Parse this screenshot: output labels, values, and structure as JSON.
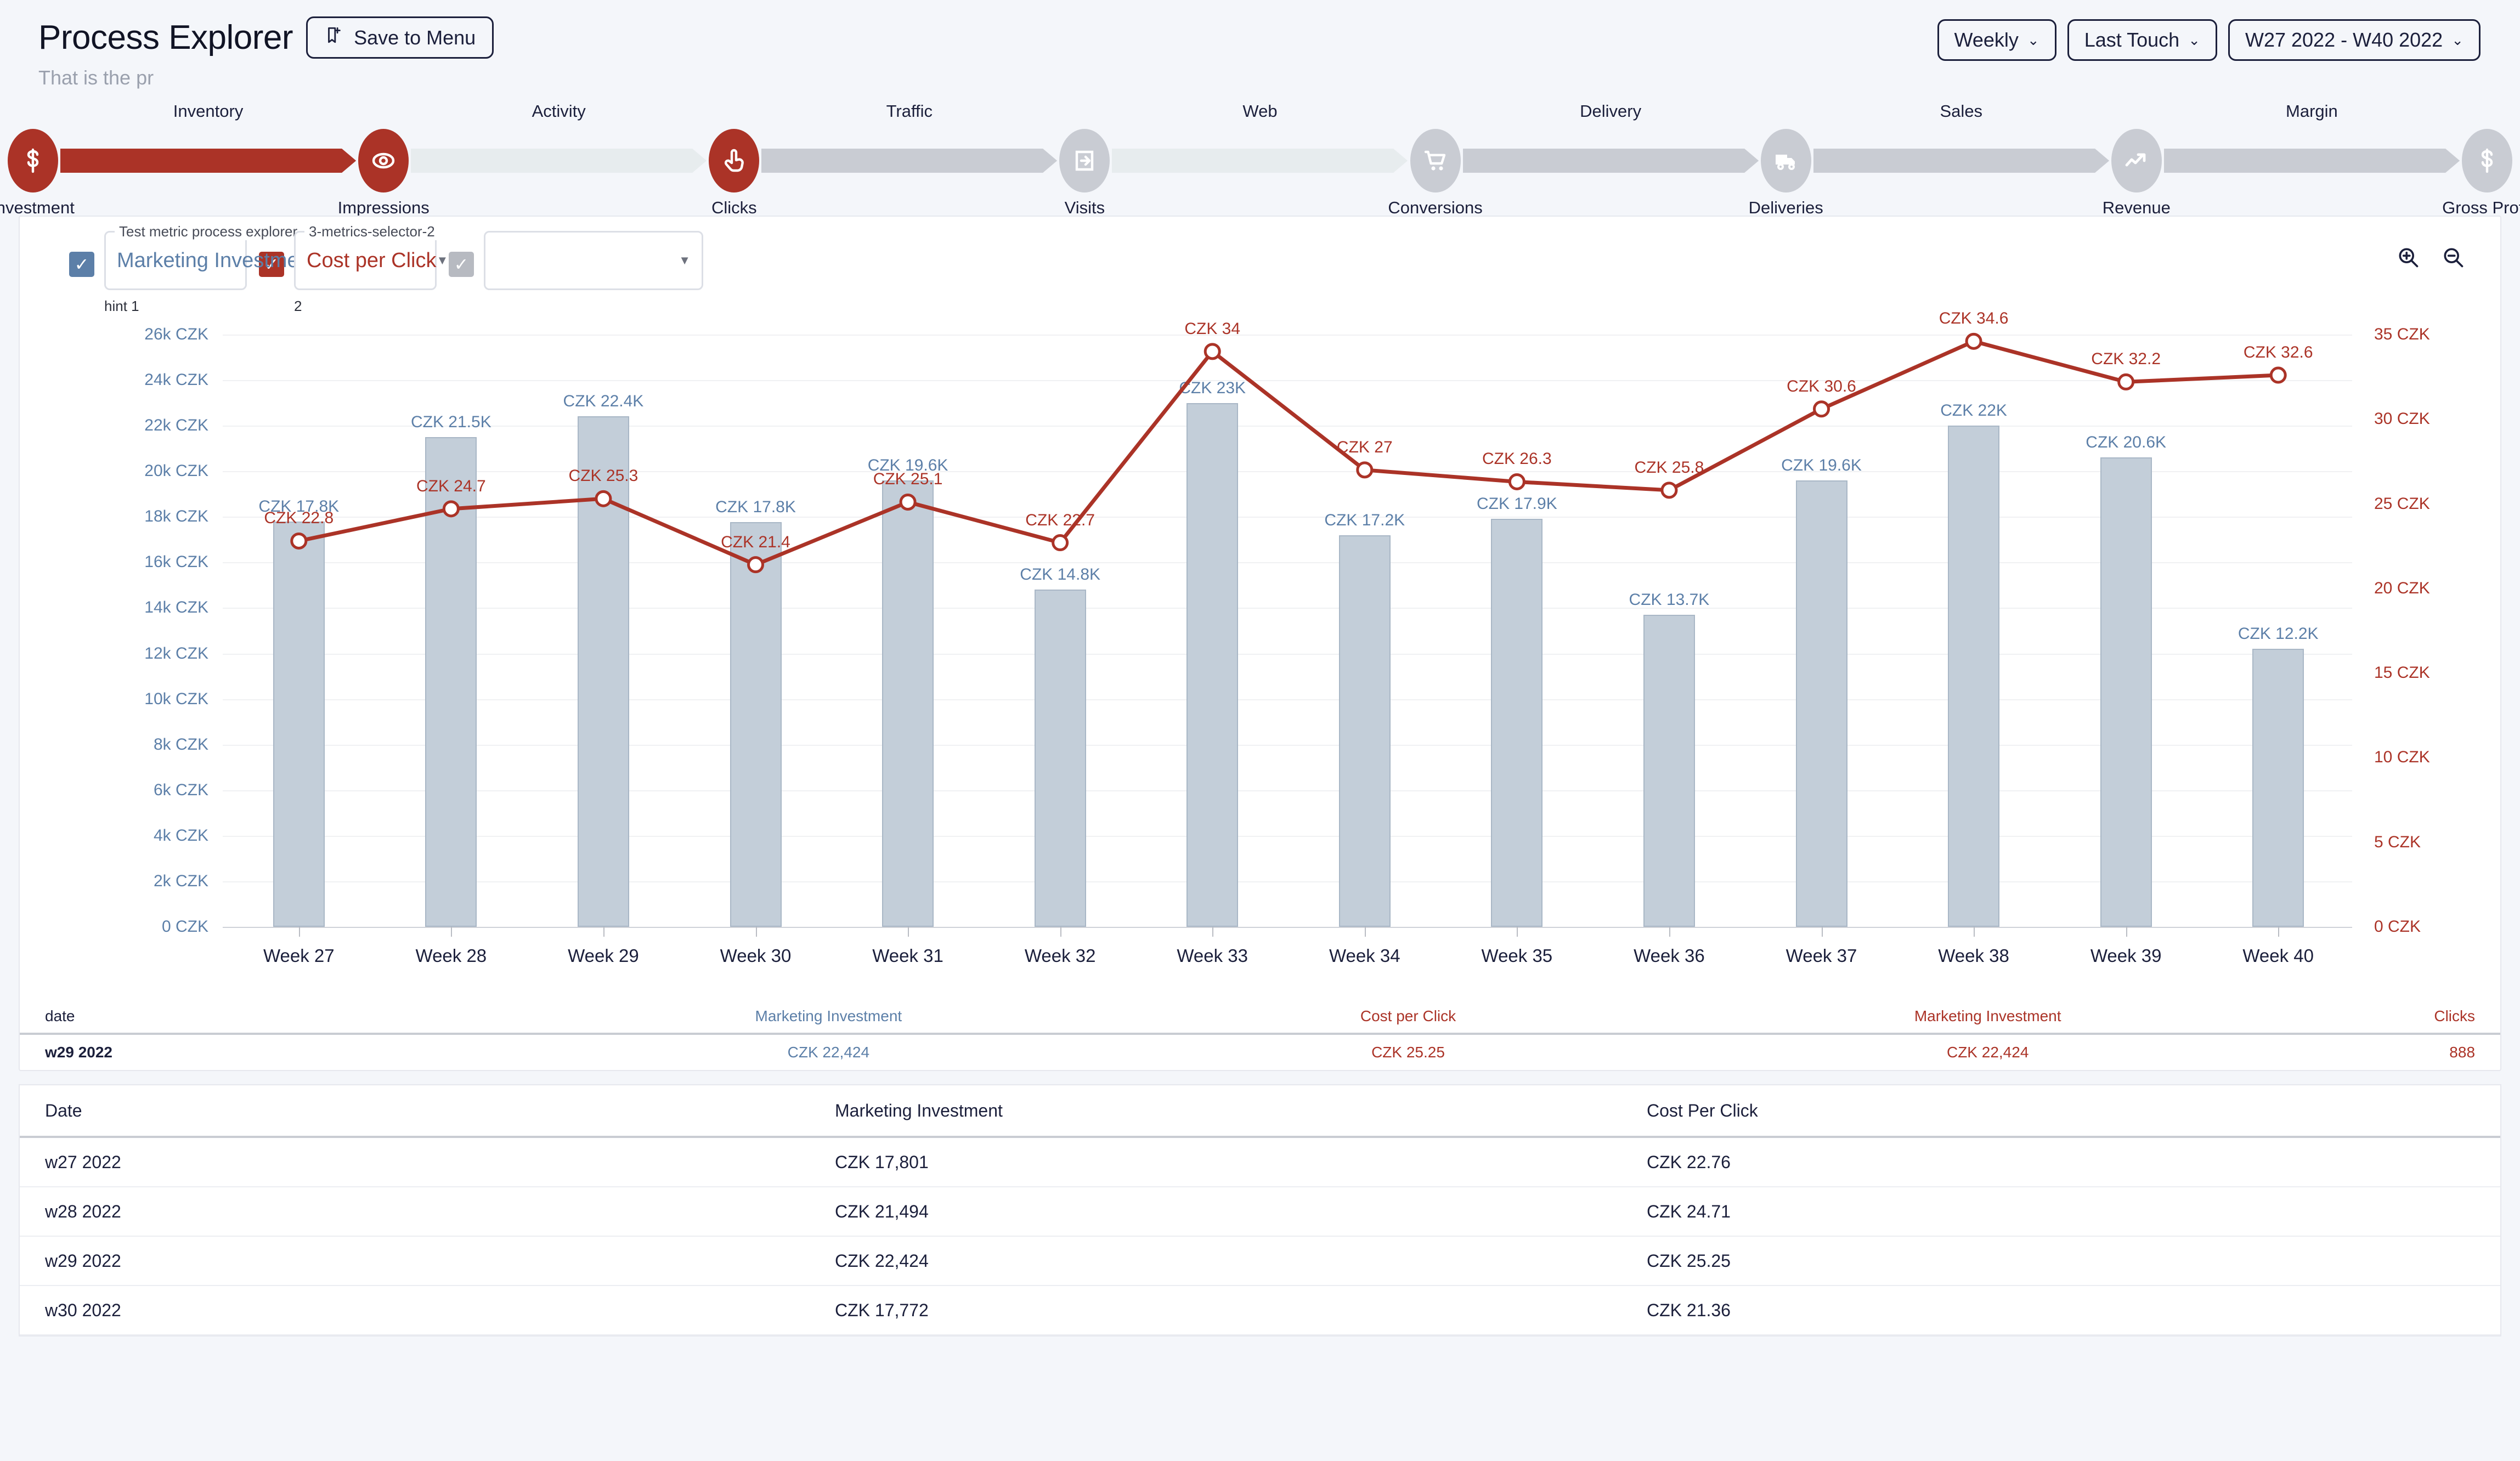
{
  "header": {
    "title": "Process Explorer",
    "subtitle": "That is the pr",
    "save_label": "Save to Menu",
    "save_icon": "bookmark-plus-icon",
    "controls": [
      {
        "label": "Weekly",
        "name": "granularity-select"
      },
      {
        "label": "Last Touch",
        "name": "attribution-select"
      },
      {
        "label": "W27 2022 - W40 2022",
        "name": "date-range-select"
      }
    ],
    "caret": "⌄"
  },
  "flow": {
    "nodes": [
      {
        "label": "Investment",
        "icon": "dollar-icon",
        "state": "active"
      },
      {
        "label": "Impressions",
        "icon": "eye-icon",
        "state": "active"
      },
      {
        "label": "Clicks",
        "icon": "click-icon",
        "state": "active"
      },
      {
        "label": "Visits",
        "icon": "login-icon",
        "state": "inactive"
      },
      {
        "label": "Conversions",
        "icon": "cart-icon",
        "state": "inactive"
      },
      {
        "label": "Deliveries",
        "icon": "truck-icon",
        "state": "inactive"
      },
      {
        "label": "Revenue",
        "icon": "trend-up-icon",
        "state": "inactive"
      },
      {
        "label": "Gross Profit",
        "icon": "dollar-icon",
        "state": "inactive"
      }
    ],
    "edges": [
      {
        "label": "Inventory",
        "state": "active"
      },
      {
        "label": "Activity",
        "state": "faint"
      },
      {
        "label": "Traffic",
        "state": "grey"
      },
      {
        "label": "Web",
        "state": "faint"
      },
      {
        "label": "Delivery",
        "state": "grey"
      },
      {
        "label": "Sales",
        "state": "grey"
      },
      {
        "label": "Margin",
        "state": "grey"
      }
    ]
  },
  "metric_selector": {
    "items": [
      {
        "legend": "Test metric process explorer",
        "value": "Marketing Investment",
        "hint": "hint 1",
        "checked": true,
        "color": "#5c7fa8",
        "check_color": "#5c7fa8"
      },
      {
        "legend": "3-metrics-selector-2",
        "value": "Cost per Click",
        "hint": "2",
        "checked": true,
        "color": "#ab3327",
        "check_color": "#ab3327"
      },
      {
        "legend": "",
        "value": "",
        "hint": "",
        "checked": true,
        "color": "#1b1f3b",
        "check_color": "#b7bac1"
      }
    ],
    "caret": "▼",
    "check_glyph": "✓"
  },
  "zoom_tools": [
    {
      "name": "zoom-in-icon",
      "title": "Zoom in"
    },
    {
      "name": "zoom-out-icon",
      "title": "Zoom out"
    }
  ],
  "chart_data": {
    "type": "bar",
    "title": "",
    "xlabel": "",
    "ylabel": "",
    "grid": true,
    "legend_position": "top",
    "categories": [
      "Week 27",
      "Week 28",
      "Week 29",
      "Week 30",
      "Week 31",
      "Week 32",
      "Week 33",
      "Week 34",
      "Week 35",
      "Week 36",
      "Week 37",
      "Week 38",
      "Week 39",
      "Week 40"
    ],
    "left_axis": {
      "label_color": "#5c7fa8",
      "ylim": [
        0,
        26000
      ],
      "ticks": [
        "0 CZK",
        "2k CZK",
        "4k CZK",
        "6k CZK",
        "8k CZK",
        "10k CZK",
        "12k CZK",
        "14k CZK",
        "16k CZK",
        "18k CZK",
        "20k CZK",
        "22k CZK",
        "24k CZK",
        "26k CZK"
      ],
      "tick_values": [
        0,
        2000,
        4000,
        6000,
        8000,
        10000,
        12000,
        14000,
        16000,
        18000,
        20000,
        22000,
        24000,
        26000
      ]
    },
    "right_axis": {
      "label_color": "#ab3327",
      "ylim": [
        0,
        35
      ],
      "ticks": [
        "0 CZK",
        "5 CZK",
        "10 CZK",
        "15 CZK",
        "20 CZK",
        "25 CZK",
        "30 CZK",
        "35 CZK"
      ],
      "tick_values": [
        0,
        5,
        10,
        15,
        20,
        25,
        30,
        35
      ]
    },
    "series": [
      {
        "name": "Marketing Investment",
        "type": "bar",
        "axis": "left",
        "color": "#c3ced9",
        "values": [
          17801,
          21494,
          22424,
          17772,
          19600,
          14800,
          23000,
          17200,
          17900,
          13700,
          19600,
          22000,
          20600,
          12200
        ],
        "labels": [
          "CZK 17.8K",
          "CZK 21.5K",
          "CZK 22.4K",
          "CZK 17.8K",
          "CZK 19.6K",
          "CZK 14.8K",
          "CZK 23K",
          "CZK 17.2K",
          "CZK 17.9K",
          "CZK 13.7K",
          "CZK 19.6K",
          "CZK 22K",
          "CZK 20.6K",
          "CZK 12.2K"
        ]
      },
      {
        "name": "Cost per Click",
        "type": "line",
        "axis": "right",
        "color": "#ab3327",
        "values": [
          22.8,
          24.7,
          25.3,
          21.4,
          25.1,
          22.7,
          34.0,
          27.0,
          26.3,
          25.8,
          30.6,
          34.6,
          32.2,
          32.6
        ],
        "labels": [
          "CZK 22.8",
          "CZK 24.7",
          "CZK 25.3",
          "CZK 21.4",
          "CZK 25.1",
          "CZK 22.7",
          "CZK 34",
          "CZK 27",
          "CZK 26.3",
          "CZK 25.8",
          "CZK 30.6",
          "CZK 34.6",
          "CZK 32.2",
          "CZK 32.6"
        ]
      }
    ]
  },
  "summary": {
    "headers": [
      "date",
      "Marketing Investment",
      "Cost per Click",
      "Marketing Investment",
      "Clicks"
    ],
    "row": [
      "w29 2022",
      "CZK 22,424",
      "CZK 25.25",
      "CZK 22,424",
      "888"
    ]
  },
  "table": {
    "headers": [
      "Date",
      "Marketing Investment",
      "Cost Per Click"
    ],
    "rows": [
      [
        "w27 2022",
        "CZK 17,801",
        "CZK 22.76"
      ],
      [
        "w28 2022",
        "CZK 21,494",
        "CZK 24.71"
      ],
      [
        "w29 2022",
        "CZK 22,424",
        "CZK 25.25"
      ],
      [
        "w30 2022",
        "CZK 17,772",
        "CZK 21.36"
      ]
    ]
  }
}
